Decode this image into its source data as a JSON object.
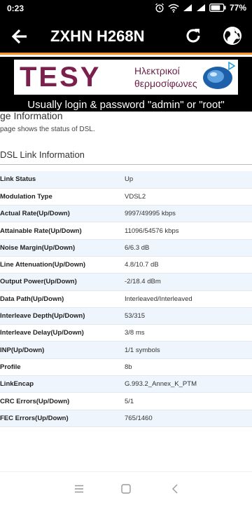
{
  "status_bar": {
    "time": "0:23",
    "battery": "77%"
  },
  "app_bar": {
    "title": "ZXHN H268N"
  },
  "ad": {
    "brand": "TESY",
    "line1": "Ηλεκτρικοί",
    "line2": "θερμοσίφωνες",
    "caption": "Usually login & password \"admin\" or \"root\""
  },
  "page": {
    "heading": "ge Information",
    "description": "page shows the status of DSL.",
    "section_title": "DSL Link Information"
  },
  "table": {
    "rows": [
      {
        "label": "Link Status",
        "value": "Up"
      },
      {
        "label": "Modulation Type",
        "value": "VDSL2"
      },
      {
        "label": "Actual Rate(Up/Down)",
        "value": "9997/49995 kbps"
      },
      {
        "label": "Attainable Rate(Up/Down)",
        "value": "11096/54576 kbps"
      },
      {
        "label": "Noise Margin(Up/Down)",
        "value": "6/6.3 dB"
      },
      {
        "label": "Line Attenuation(Up/Down)",
        "value": "4.8/10.7 dB"
      },
      {
        "label": "Output Power(Up/Down)",
        "value": "-2/18.4 dBm"
      },
      {
        "label": "Data Path(Up/Down)",
        "value": "Interleaved/Interleaved"
      },
      {
        "label": "Interleave Depth(Up/Down)",
        "value": "53/315"
      },
      {
        "label": "Interleave Delay(Up/Down)",
        "value": "3/8 ms"
      },
      {
        "label": "INP(Up/Down)",
        "value": "1/1 symbols"
      },
      {
        "label": "Profile",
        "value": "8b"
      },
      {
        "label": "LinkEncap",
        "value": "G.993.2_Annex_K_PTM"
      },
      {
        "label": "CRC Errors(Up/Down)",
        "value": "5/1"
      },
      {
        "label": "FEC Errors(Up/Down)",
        "value": "765/1460"
      }
    ]
  },
  "icons": {
    "back": "arrow-left-icon",
    "refresh": "refresh-icon",
    "globe": "globe-icon",
    "nav_menu": "menu-icon",
    "nav_home": "home-square-icon",
    "nav_back": "back-triangle-icon"
  }
}
